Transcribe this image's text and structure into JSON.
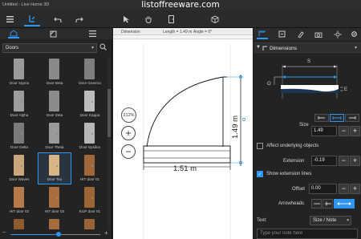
{
  "window": {
    "title": "Untitled - Live Home 3D",
    "watermark": "listoffreeware.com"
  },
  "toolbar": {
    "icons": [
      "menu-icon",
      "build-icon",
      "undo-icon",
      "redo-icon",
      "select-arrow-icon",
      "hand-icon",
      "door-icon",
      "box-3d-icon"
    ]
  },
  "library": {
    "category": "Doors",
    "items": [
      {
        "label": "Door Sigma",
        "color": "#9a9a9a"
      },
      {
        "label": "Door Beta",
        "color": "#8a8a8a"
      },
      {
        "label": "Door Gamma",
        "color": "#7f7f7f"
      },
      {
        "label": "Door Alpha",
        "color": "#9c9c9c"
      },
      {
        "label": "Door Zeta",
        "color": "#8c8c8c"
      },
      {
        "label": "Door Kappa",
        "color": "#bdbdbd"
      },
      {
        "label": "Door Delta",
        "color": "#7a7a7a"
      },
      {
        "label": "Door Theta",
        "color": "#9a9a9a"
      },
      {
        "label": "Door Epsilon",
        "color": "#b7b7b7"
      },
      {
        "label": "Door Waves",
        "color": "#c9a77a"
      },
      {
        "label": "Door Tau",
        "color": "#d8b688"
      },
      {
        "label": "HIT door 01",
        "color": "#a0683a"
      },
      {
        "label": "HIT door 02",
        "color": "#b57a48"
      },
      {
        "label": "HIT door 03",
        "color": "#a86e3f"
      },
      {
        "label": "KUP door 01",
        "color": "#9c6536"
      },
      {
        "label": "",
        "color": "#8e5a30"
      },
      {
        "label": "",
        "color": "#a46c3c"
      },
      {
        "label": "",
        "color": "#9a6335"
      }
    ],
    "selected_index": 10
  },
  "plan": {
    "dimension_tab": "Dimension",
    "length_readout": "Length = 1.49 m",
    "angle_readout": "Angle = 0°",
    "zoom": "212%",
    "zoom_in": "+",
    "zoom_out": "−",
    "width_label": "1.51 m",
    "height_label": "1.49 m"
  },
  "properties": {
    "section_title": "Dimensions",
    "diagram_labels": {
      "size": "S",
      "offset": "O",
      "extension": "E"
    },
    "size_label": "Size",
    "size_value": "1.49",
    "affect_label": "Affect underlying objects",
    "affect_checked": false,
    "extension_label": "Extension",
    "extension_value": "-0.19",
    "show_ext_label": "Show extension lines",
    "show_ext_checked": true,
    "offset_label": "Offset",
    "offset_value": "0.00",
    "arrowheads_label": "Arrowheads",
    "text_label": "Text:",
    "text_style": "Size / Note",
    "note_placeholder": "Type your note here",
    "minus": "−",
    "plus": "+",
    "check_mark": "✓"
  }
}
